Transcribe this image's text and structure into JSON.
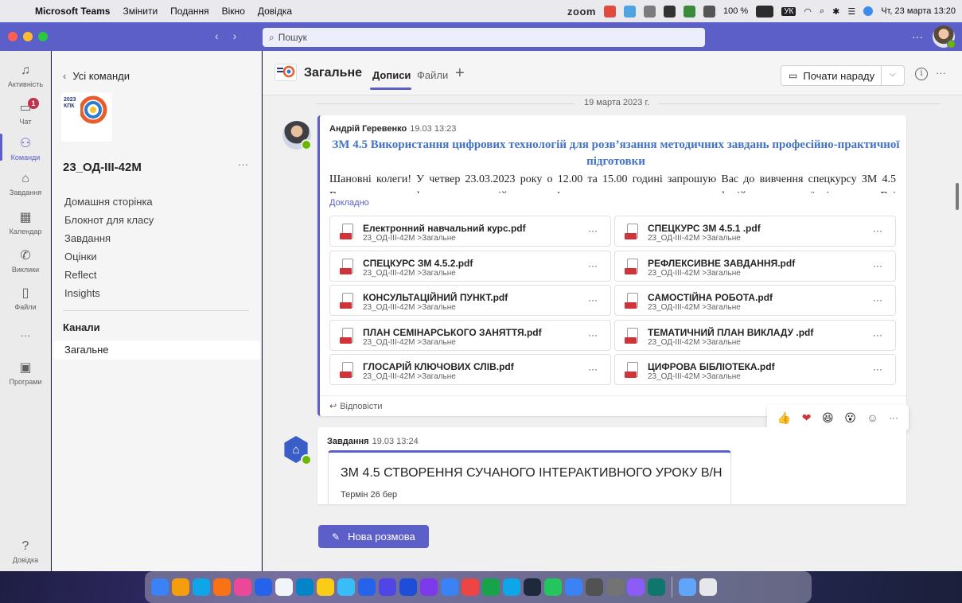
{
  "menubar": {
    "app": "Microsoft Teams",
    "items": [
      "Змінити",
      "Подання",
      "Вікно",
      "Довідка"
    ],
    "zoom": "zoom",
    "battery": "100 %",
    "keyboard": "УК",
    "clock": "Чт, 23 марта  13:20"
  },
  "titlebar": {
    "search_placeholder": "Пошук",
    "more": "···"
  },
  "rail": {
    "activity": "Активність",
    "chat": "Чат",
    "chat_badge": "1",
    "teams": "Команди",
    "assignments": "Завдання",
    "calendar": "Календар",
    "calls": "Виклики",
    "files": "Файли",
    "more": "···",
    "apps": "Програми",
    "help": "Довідка"
  },
  "team": {
    "back": "Усі команди",
    "logo_text": "2023 КПК",
    "name": "23_ОД-ІІІ-42М",
    "more": "···",
    "nav": [
      "Домашня сторінка",
      "Блокнот для класу",
      "Завдання",
      "Оцінки",
      "Reflect",
      "Insights"
    ],
    "channels_heading": "Канали",
    "active_channel": "Загальне"
  },
  "channel": {
    "title": "Загальне",
    "tab_posts": "Дописи",
    "tab_files": "Файли",
    "add_tab": "+",
    "meet_button": "Почати нараду",
    "date_separator": "19 марта 2023 г."
  },
  "post1": {
    "author": "Андрій Геревенко",
    "time": "19.03 13:23",
    "title": "ЗМ 4.5 Використання цифрових технологій для розв’язання методичних завдань професійно-практичної підготовки",
    "body": "Шановні колеги! У четвер 23.03.2023 року о 12.00 та 15.00 годині запрошую Вас до вивчення спецкурсу ЗМ 4.5 Використання цифрових технологій для розв’язання методичних завдань професійно-практичної підготовки. Всі матеріали",
    "more_link": "Докладно",
    "reply": "Відповісти",
    "files": [
      {
        "name": "Електронний навчальний курс.pdf",
        "path": "23_ОД-ІІІ-42М >Загальне"
      },
      {
        "name": "СПЕЦКУРС ЗМ 4.5.1 .pdf",
        "path": "23_ОД-ІІІ-42М >Загальне"
      },
      {
        "name": "СПЕЦКУРС ЗМ 4.5.2.pdf",
        "path": "23_ОД-ІІІ-42М >Загальне"
      },
      {
        "name": "РЕФЛЕКСИВНЕ ЗАВДАННЯ.pdf",
        "path": "23_ОД-ІІІ-42М >Загальне"
      },
      {
        "name": "КОНСУЛЬТАЦІЙНИЙ ПУНКТ.pdf",
        "path": "23_ОД-ІІІ-42М >Загальне"
      },
      {
        "name": "САМОСТІЙНА РОБОТА.pdf",
        "path": "23_ОД-ІІІ-42М >Загальне"
      },
      {
        "name": "ПЛАН СЕМІНАРСЬКОГО ЗАНЯТТЯ.pdf",
        "path": "23_ОД-ІІІ-42М >Загальне"
      },
      {
        "name": "ТЕМАТИЧНИЙ ПЛАН ВИКЛАДУ .pdf",
        "path": "23_ОД-ІІІ-42М >Загальне"
      },
      {
        "name": "ГЛОСАРІЙ КЛЮЧОВИХ СЛІВ.pdf",
        "path": "23_ОД-ІІІ-42М >Загальне"
      },
      {
        "name": "ЦИФРОВА БІБЛІОТЕКА.pdf",
        "path": "23_ОД-ІІІ-42М >Загальне"
      }
    ],
    "file_more": "···"
  },
  "reactions": {
    "like": "👍",
    "heart": "❤",
    "laugh": "😆",
    "surprised": "😮",
    "more": "···"
  },
  "post2": {
    "author": "Завдання",
    "time": "19.03 13:24",
    "task_title": "ЗМ 4.5 СТВОРЕННЯ СУЧАНОГО ІНТЕРАКТИВНОГО УРОКУ В/Н",
    "due": "Термін 26 бер"
  },
  "compose": {
    "new_conversation": "Нова розмова"
  },
  "colors": {
    "brand": "#5b5fc7",
    "title_blue": "#4472c4",
    "presence": "#6bb700",
    "badge": "#c4314b"
  }
}
